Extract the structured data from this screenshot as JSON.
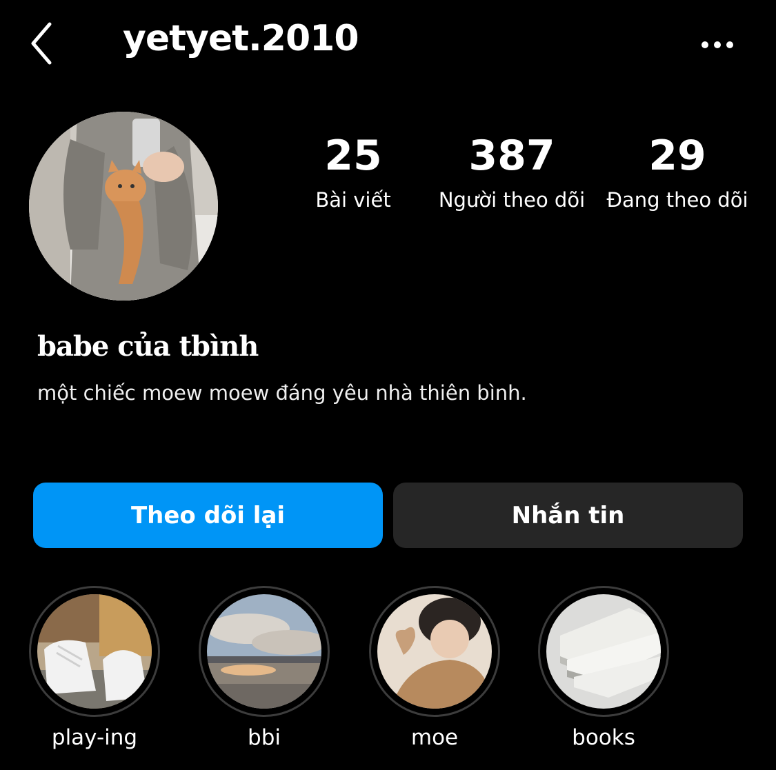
{
  "header": {
    "username": "yetyet.2010",
    "back_icon": "chevron-left-icon",
    "more_icon": "more-horizontal-icon"
  },
  "profile": {
    "display_name": "babe của tbình",
    "bio": "một chiếc moew moew đáng yêu nhà thiên bình."
  },
  "stats": [
    {
      "value": "25",
      "label": "Bài viết"
    },
    {
      "value": "387",
      "label": "Người theo dõi"
    },
    {
      "value": "29",
      "label": "Đang theo dõi"
    }
  ],
  "actions": {
    "follow_back_label": "Theo dõi lại",
    "message_label": "Nhắn tin"
  },
  "highlights": [
    {
      "label": "play-ing"
    },
    {
      "label": "bbi"
    },
    {
      "label": "moe"
    },
    {
      "label": "books"
    }
  ],
  "colors": {
    "background": "#000000",
    "primary_button": "#0095f6",
    "secondary_button": "#262626",
    "highlight_ring": "#3c3c3c"
  }
}
